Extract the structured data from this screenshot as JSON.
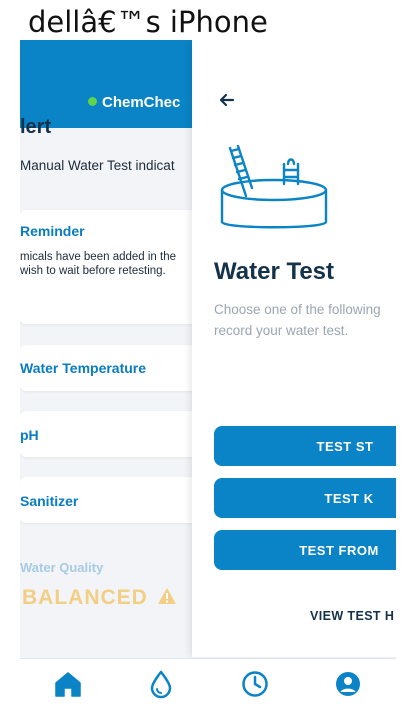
{
  "device": {
    "title": "dellâ€™s iPhone"
  },
  "header": {
    "brand": "ChemChec"
  },
  "background": {
    "alert_heading": "lert",
    "alert_text": "Manual Water Test indicat",
    "reminder": {
      "title": "Reminder",
      "body_line1": "micals have been added in the",
      "body_line2": "wish to wait before retesting."
    },
    "metrics": [
      "Water Temperature",
      "pH",
      "Sanitizer"
    ],
    "water_quality": {
      "label": "Water Quality",
      "status": "BALANCED"
    }
  },
  "drawer": {
    "title": "Water Test",
    "description_line1": "Choose one of the following",
    "description_line2": "record your water test.",
    "buttons": [
      "TEST ST",
      "TEST K",
      "TEST FROM"
    ],
    "view_history": "VIEW TEST H"
  },
  "tabs": [
    {
      "icon": "home-icon"
    },
    {
      "icon": "water-drop-icon"
    },
    {
      "icon": "clock-icon"
    },
    {
      "icon": "user-icon"
    }
  ],
  "colors": {
    "primary": "#0a84c6",
    "dark_text": "#14324a",
    "balanced": "#f3cf85",
    "status_dot": "#5fd34a"
  }
}
